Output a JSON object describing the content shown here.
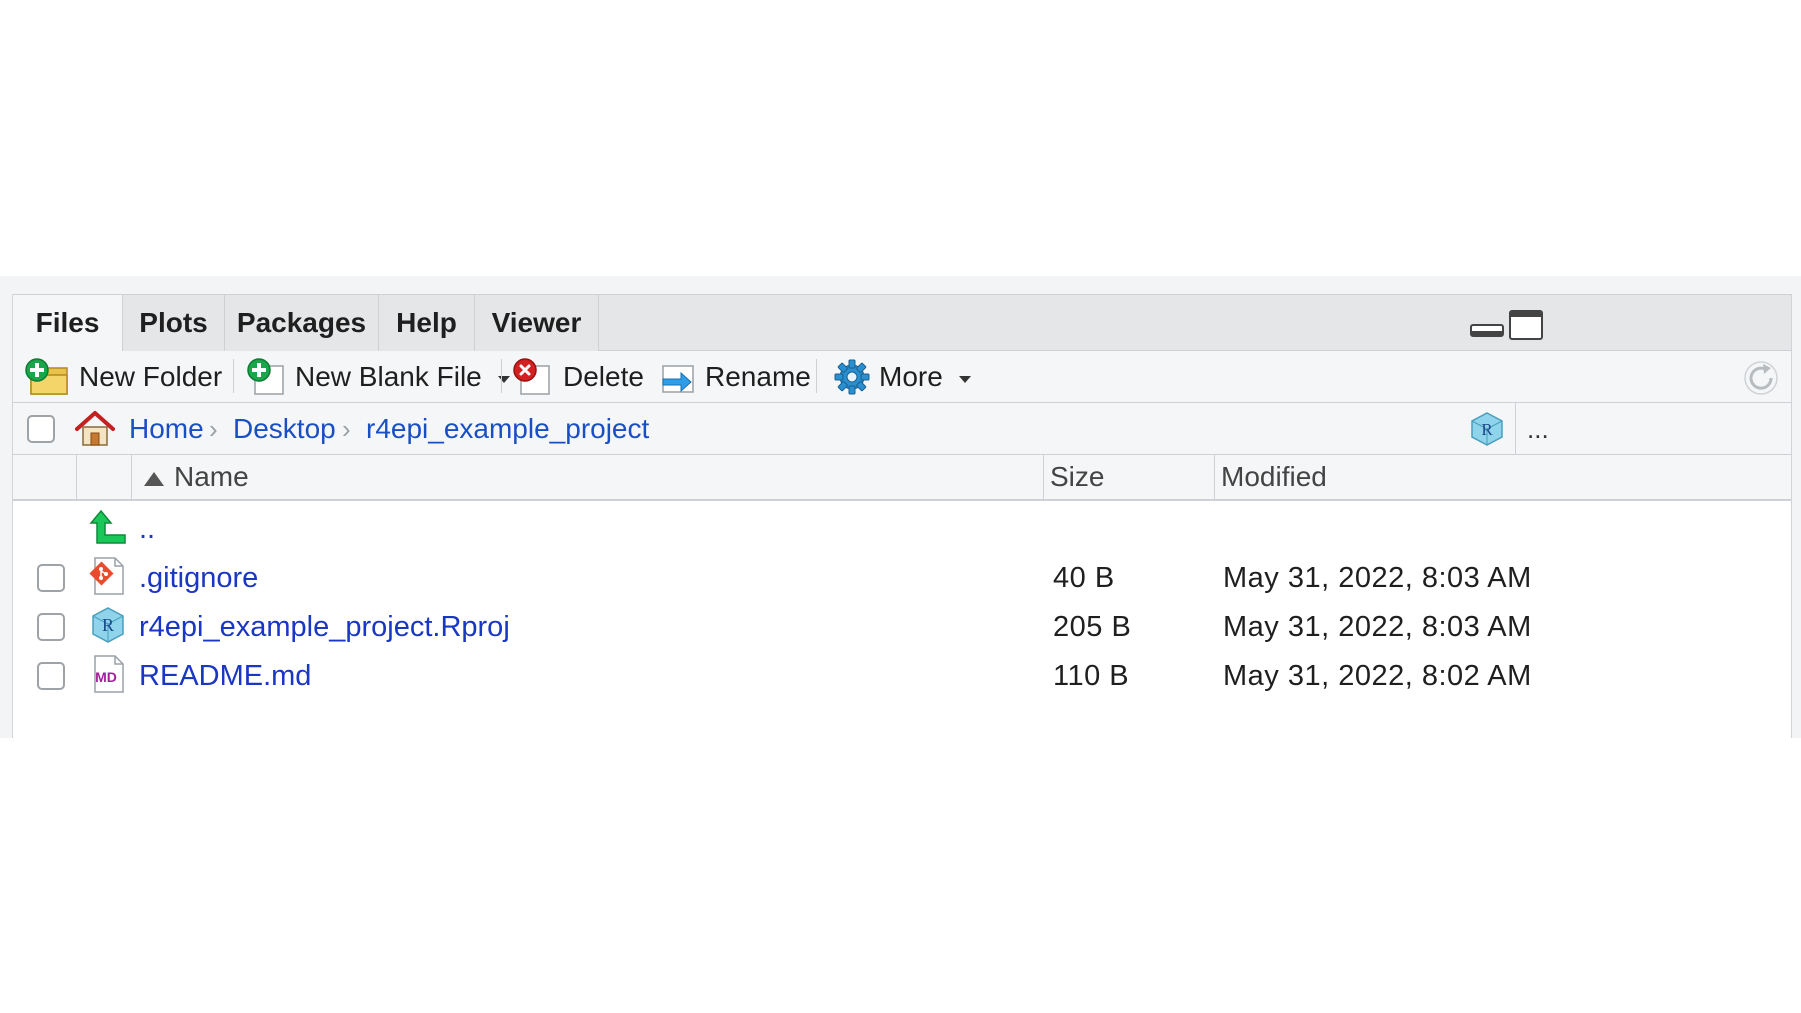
{
  "tabs": [
    {
      "label": "Files",
      "active": true
    },
    {
      "label": "Plots",
      "active": false
    },
    {
      "label": "Packages",
      "active": false
    },
    {
      "label": "Help",
      "active": false
    },
    {
      "label": "Viewer",
      "active": false
    }
  ],
  "toolbar": {
    "new_folder": "New Folder",
    "new_blank_file": "New Blank File",
    "delete": "Delete",
    "rename": "Rename",
    "more": "More"
  },
  "path": {
    "home_icon": "home-icon",
    "crumbs": [
      "Home",
      "Desktop",
      "r4epi_example_project"
    ],
    "overflow": "..."
  },
  "columns": {
    "name": "Name",
    "size": "Size",
    "modified": "Modified",
    "sort_indicator": "ascending"
  },
  "parent_dir": "..",
  "files": [
    {
      "name": ".gitignore",
      "size": "40 B",
      "modified": "May 31, 2022, 8:03 AM",
      "icon": "git-file-icon"
    },
    {
      "name": "r4epi_example_project.Rproj",
      "size": "205 B",
      "modified": "May 31, 2022, 8:03 AM",
      "icon": "rproj-file-icon"
    },
    {
      "name": "README.md",
      "size": "110 B",
      "modified": "May 31, 2022, 8:02 AM",
      "icon": "markdown-file-icon"
    }
  ],
  "colors": {
    "link": "#1a36c4",
    "toolbar_bg": "#f5f6f7",
    "tab_bg": "#e4e6e8",
    "border": "#cdd0d4"
  }
}
